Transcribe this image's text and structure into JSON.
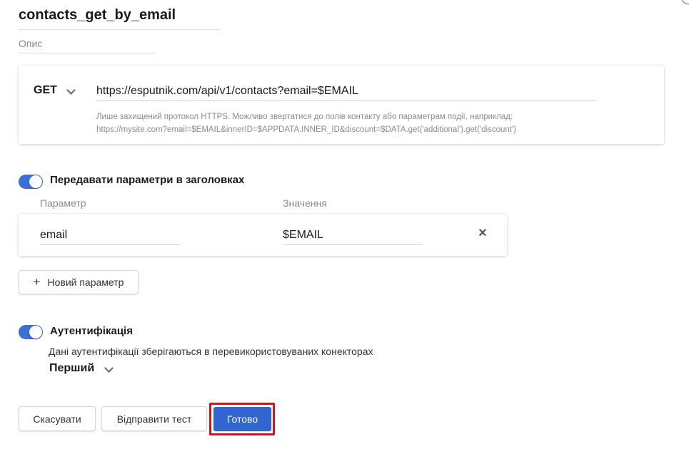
{
  "header": {
    "title": "contacts_get_by_email",
    "description_placeholder": "Опис"
  },
  "request": {
    "method": "GET",
    "url": "https://esputnik.com/api/v1/contacts?email=$EMAIL",
    "hint_line1": "Лише захищений протокол HTTPS. Можливо звертатися до полів контакту або параметрам події, наприклад:",
    "hint_line2": "https://mysite.com?email=$EMAIL&innerID=$APPDATA.INNER_ID&discount=$DATA.get('additional').get('discount')"
  },
  "headers_section": {
    "toggle_on": true,
    "label": "Передавати параметри в заголовках",
    "column_param": "Параметр",
    "column_value": "Значення",
    "params": [
      {
        "name": "email",
        "value": "$EMAIL"
      }
    ],
    "remove_icon": "×",
    "add_label": "Новий параметр",
    "add_icon": "+"
  },
  "auth_section": {
    "toggle_on": true,
    "label": "Аутентифікація",
    "note": "Дані аутентифікації зберігаються в перевикористовуваних конекторах",
    "selected": "Перший"
  },
  "footer": {
    "cancel_label": "Скасувати",
    "test_label": "Відправити тест",
    "done_label": "Готово"
  },
  "colors": {
    "accent": "#2f66d0",
    "toggle": "#3a6fd8",
    "highlight": "#d4141b"
  }
}
